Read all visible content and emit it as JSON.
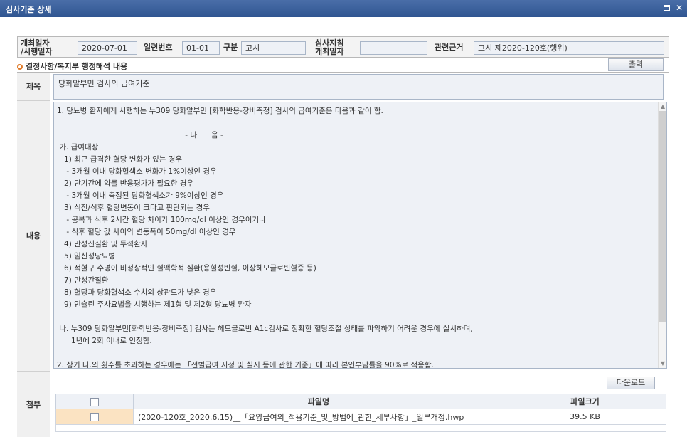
{
  "window": {
    "title": "심사기준 상세",
    "maximize_icon": "window-maximize-icon",
    "close_icon": "close-icon",
    "close_glyph": "✕"
  },
  "meta": {
    "open_date_label_line1": "개최일자",
    "open_date_label_line2": "/시행일자",
    "open_date": "2020-07-01",
    "serial_label": "일련번호",
    "serial": "01-01",
    "type_label": "구분",
    "type": "고시",
    "guide_label_line1": "심사지침",
    "guide_label_line2": "개최일자",
    "guide_date": "",
    "basis_label": "관련근거",
    "basis": "고시 제2020-120호(행위)"
  },
  "section": {
    "title": "결정사항/복지부 행정해석 내용",
    "print_button": "출력"
  },
  "detail": {
    "subject_label": "제목",
    "subject": "당화알부민 검사의 급여기준",
    "content_label": "내용",
    "content_lines": [
      "1. 당뇨병 환자에게 시행하는 누309 당화알부민 [화학반응-장비측정] 검사의 급여기준은 다음과 같이 함.",
      "",
      "                                                      - 다      음 -",
      " 가. 급여대상",
      "   1) 최근 급격한 혈당 변화가 있는 경우",
      "    - 3개월 이내 당화혈색소 변화가 1%이상인 경우",
      "   2) 단기간에 약물 반응평가가 필요한 경우",
      "    - 3개월 이내 측정된 당화혈색소가 9%이상인 경우",
      "   3) 식전/식후 혈당변동이 크다고 판단되는 경우",
      "    - 공복과 식후 2시간 혈당 차이가 100mg/dl 이상인 경우이거나",
      "    - 식후 혈당 값 사이의 변동폭이 50mg/dl 이상인 경우",
      "   4) 만성신질환 및 투석환자",
      "   5) 임신성당뇨병",
      "   6) 적혈구 수명이 비정상적인 혈액학적 질환(용혈성빈혈, 이상헤모글로빈혈증 등)",
      "   7) 만성간질환",
      "   8) 혈당과 당화혈색소 수치의 상관도가 낮은 경우",
      "   9) 인슐린 주사요법을 시행하는 제1형 및 제2형 당뇨병 환자",
      "",
      " 나. 누309 당화알부민[화학반응-장비측정] 검사는 헤모글로빈 A1c검사로 정확한 혈당조절 상태를 파악하기 어려운 경우에 실시하며,",
      "      1년에 2회 이내로 인정함.",
      "",
      "2. 상기 나.의 횟수를 초과하는 경우에는 「선별급여 지정 및 실시 등에 관한 기준」에 따라 본인부담률을 90%로 적용함."
    ],
    "attach_label": "첨부",
    "download_button": "다운로드",
    "file_table": {
      "col_name": "파일명",
      "col_size": "파일크기",
      "rows": [
        {
          "name": "(2020-120호_2020.6.15)__「요양급여의_적용기준_및_방법에_관한_세부사항」_일부개정.hwp",
          "size": "39.5 KB"
        }
      ]
    }
  }
}
